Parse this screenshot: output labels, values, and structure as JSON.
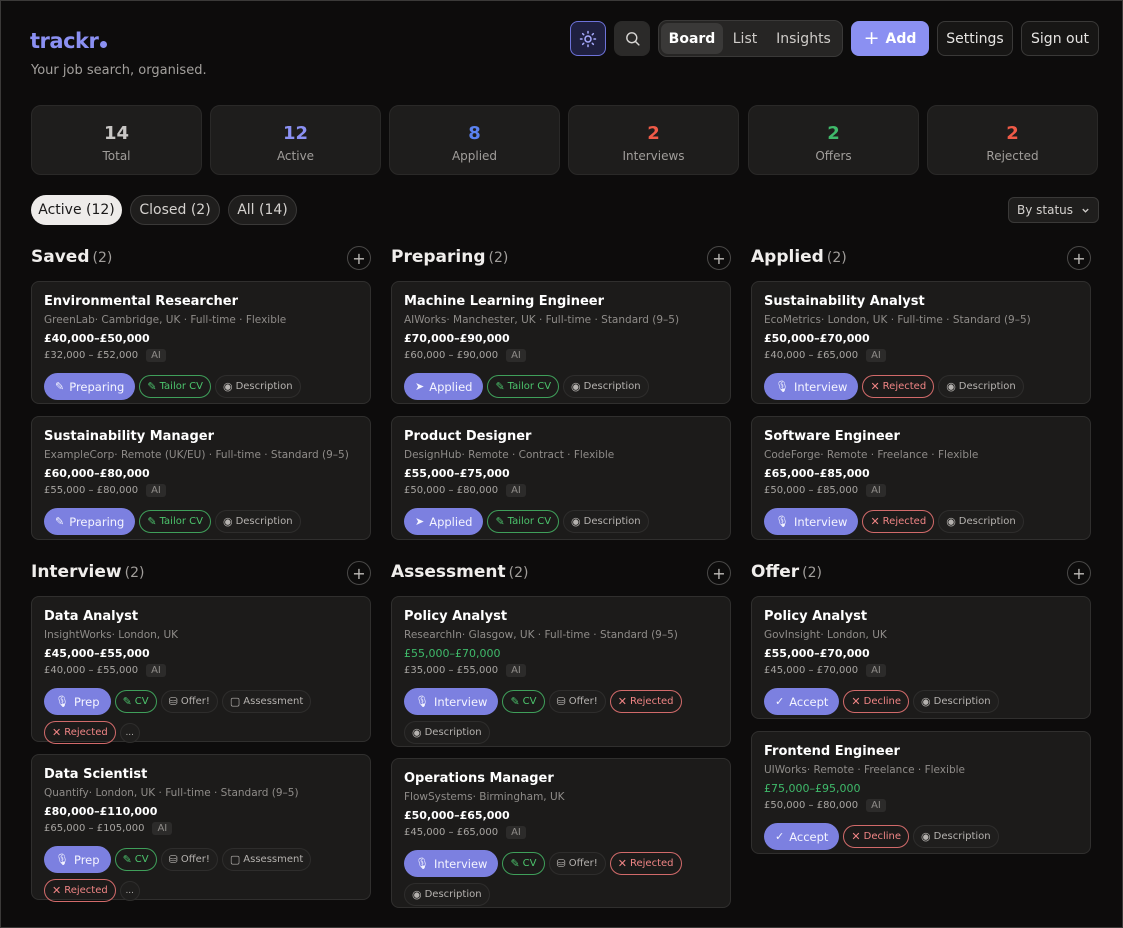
{
  "brand": {
    "name": "trackr",
    "tagline": "Your job search, organised."
  },
  "header": {
    "theme_icon": "sun-icon",
    "search_icon": "search-icon",
    "views": [
      "Board",
      "List",
      "Insights"
    ],
    "active_view": "Board",
    "add_label": "Add",
    "settings_label": "Settings",
    "signout_label": "Sign out"
  },
  "stats": [
    {
      "value": "14",
      "label": "Total",
      "color": "#c8c6c4"
    },
    {
      "value": "12",
      "label": "Active",
      "color": "#8b90f2"
    },
    {
      "value": "8",
      "label": "Applied",
      "color": "#5b82f0"
    },
    {
      "value": "2",
      "label": "Interviews",
      "color": "#ef5a47"
    },
    {
      "value": "2",
      "label": "Offers",
      "color": "#3fb96a"
    },
    {
      "value": "2",
      "label": "Rejected",
      "color": "#ef5a47"
    }
  ],
  "filters": {
    "chips": [
      "Active (12)",
      "Closed (2)",
      "All (14)"
    ],
    "active": "Active (12)",
    "sort_label": "By status"
  },
  "columns": [
    {
      "title": "Saved",
      "count": "(2)",
      "cards": [
        {
          "title": "Environmental Researcher",
          "meta": "GreenLab· Cambridge, UK · Full-time · Flexible",
          "salary": "£40,000–£50,000",
          "salary_green": false,
          "ai_range": "£32,000 – £52,000",
          "ai": "AI",
          "actions": [
            {
              "label": "Preparing",
              "kind": "primary",
              "icon": "✎",
              "icon_name": "pencil-icon"
            },
            {
              "label": "Tailor CV",
              "kind": "green",
              "icon": "✎",
              "icon_name": "pencil-icon"
            },
            {
              "label": "Description",
              "kind": "gray",
              "icon": "◉",
              "icon_name": "eye-icon"
            }
          ]
        },
        {
          "title": "Sustainability Manager",
          "meta": "ExampleCorp· Remote (UK/EU) · Full-time · Standard (9–5)",
          "salary": "£60,000–£80,000",
          "salary_green": false,
          "ai_range": "£55,000 – £80,000",
          "ai": "AI",
          "actions": [
            {
              "label": "Preparing",
              "kind": "primary",
              "icon": "✎",
              "icon_name": "pencil-icon"
            },
            {
              "label": "Tailor CV",
              "kind": "green",
              "icon": "✎",
              "icon_name": "pencil-icon"
            },
            {
              "label": "Description",
              "kind": "gray",
              "icon": "◉",
              "icon_name": "eye-icon"
            }
          ]
        }
      ]
    },
    {
      "title": "Preparing",
      "count": "(2)",
      "cards": [
        {
          "title": "Machine Learning Engineer",
          "meta": "AIWorks· Manchester, UK · Full-time · Standard (9–5)",
          "salary": "£70,000–£90,000",
          "salary_green": false,
          "ai_range": "£60,000 – £90,000",
          "ai": "AI",
          "actions": [
            {
              "label": "Applied",
              "kind": "primary",
              "icon": "➤",
              "icon_name": "send-icon"
            },
            {
              "label": "Tailor CV",
              "kind": "green",
              "icon": "✎",
              "icon_name": "pencil-icon"
            },
            {
              "label": "Description",
              "kind": "gray",
              "icon": "◉",
              "icon_name": "eye-icon"
            }
          ]
        },
        {
          "title": "Product Designer",
          "meta": "DesignHub· Remote · Contract · Flexible",
          "salary": "£55,000–£75,000",
          "salary_green": false,
          "ai_range": "£50,000 – £80,000",
          "ai": "AI",
          "actions": [
            {
              "label": "Applied",
              "kind": "primary",
              "icon": "➤",
              "icon_name": "send-icon"
            },
            {
              "label": "Tailor CV",
              "kind": "green",
              "icon": "✎",
              "icon_name": "pencil-icon"
            },
            {
              "label": "Description",
              "kind": "gray",
              "icon": "◉",
              "icon_name": "eye-icon"
            }
          ]
        }
      ]
    },
    {
      "title": "Applied",
      "count": "(2)",
      "cards": [
        {
          "title": "Sustainability Analyst",
          "meta": "EcoMetrics· London, UK · Full-time · Standard (9–5)",
          "salary": "£50,000–£70,000",
          "salary_green": false,
          "ai_range": "£40,000 – £65,000",
          "ai": "AI",
          "actions": [
            {
              "label": "Interview",
              "kind": "primary",
              "icon": "🎙",
              "icon_name": "microphone-icon"
            },
            {
              "label": "Rejected",
              "kind": "red",
              "icon": "✕",
              "icon_name": "x-icon"
            },
            {
              "label": "Description",
              "kind": "gray",
              "icon": "◉",
              "icon_name": "eye-icon"
            }
          ]
        },
        {
          "title": "Software Engineer",
          "meta": "CodeForge· Remote · Freelance · Flexible",
          "salary": "£65,000–£85,000",
          "salary_green": false,
          "ai_range": "£50,000 – £85,000",
          "ai": "AI",
          "actions": [
            {
              "label": "Interview",
              "kind": "primary",
              "icon": "🎙",
              "icon_name": "microphone-icon"
            },
            {
              "label": "Rejected",
              "kind": "red",
              "icon": "✕",
              "icon_name": "x-icon"
            },
            {
              "label": "Description",
              "kind": "gray",
              "icon": "◉",
              "icon_name": "eye-icon"
            }
          ]
        }
      ]
    },
    {
      "title": "Interview",
      "count": "(2)",
      "cards": [
        {
          "title": "Data Analyst",
          "meta": "InsightWorks· London, UK",
          "salary": "£45,000–£55,000",
          "salary_green": false,
          "ai_range": "£40,000 – £55,000",
          "ai": "AI",
          "actions": [
            {
              "label": "Prep",
              "kind": "primary",
              "icon": "🎙",
              "icon_name": "microphone-icon"
            },
            {
              "label": "CV",
              "kind": "green",
              "icon": "✎",
              "icon_name": "pencil-icon"
            },
            {
              "label": "Offer!",
              "kind": "gray",
              "icon": "⛁",
              "icon_name": "gift-icon"
            },
            {
              "label": "Assessment",
              "kind": "gray",
              "icon": "▢",
              "icon_name": "clipboard-icon"
            },
            {
              "label": "Rejected",
              "kind": "red",
              "icon": "✕",
              "icon_name": "x-icon"
            },
            {
              "label": "...",
              "kind": "more",
              "icon": "",
              "icon_name": "more-icon"
            }
          ]
        },
        {
          "title": "Data Scientist",
          "meta": "Quantify· London, UK · Full-time · Standard (9–5)",
          "salary": "£80,000–£110,000",
          "salary_green": false,
          "ai_range": "£65,000 – £105,000",
          "ai": "AI",
          "actions": [
            {
              "label": "Prep",
              "kind": "primary",
              "icon": "🎙",
              "icon_name": "microphone-icon"
            },
            {
              "label": "CV",
              "kind": "green",
              "icon": "✎",
              "icon_name": "pencil-icon"
            },
            {
              "label": "Offer!",
              "kind": "gray",
              "icon": "⛁",
              "icon_name": "gift-icon"
            },
            {
              "label": "Assessment",
              "kind": "gray",
              "icon": "▢",
              "icon_name": "clipboard-icon"
            },
            {
              "label": "Rejected",
              "kind": "red",
              "icon": "✕",
              "icon_name": "x-icon"
            },
            {
              "label": "...",
              "kind": "more",
              "icon": "",
              "icon_name": "more-icon"
            }
          ]
        }
      ]
    },
    {
      "title": "Assessment",
      "count": "(2)",
      "cards": [
        {
          "title": "Policy Analyst",
          "meta": "ResearchIn· Glasgow, UK · Full-time · Standard (9–5)",
          "salary": "£55,000–£70,000",
          "salary_green": true,
          "ai_range": "£35,000 – £55,000",
          "ai": "AI",
          "actions": [
            {
              "label": "Interview",
              "kind": "primary",
              "icon": "🎙",
              "icon_name": "microphone-icon"
            },
            {
              "label": "CV",
              "kind": "green",
              "icon": "✎",
              "icon_name": "pencil-icon"
            },
            {
              "label": "Offer!",
              "kind": "gray",
              "icon": "⛁",
              "icon_name": "gift-icon"
            },
            {
              "label": "Rejected",
              "kind": "red",
              "icon": "✕",
              "icon_name": "x-icon"
            },
            {
              "label": "Description",
              "kind": "gray",
              "icon": "◉",
              "icon_name": "eye-icon"
            }
          ]
        },
        {
          "title": "Operations Manager",
          "meta": "FlowSystems· Birmingham, UK",
          "salary": "£50,000–£65,000",
          "salary_green": false,
          "ai_range": "£45,000 – £65,000",
          "ai": "AI",
          "actions": [
            {
              "label": "Interview",
              "kind": "primary",
              "icon": "🎙",
              "icon_name": "microphone-icon"
            },
            {
              "label": "CV",
              "kind": "green",
              "icon": "✎",
              "icon_name": "pencil-icon"
            },
            {
              "label": "Offer!",
              "kind": "gray",
              "icon": "⛁",
              "icon_name": "gift-icon"
            },
            {
              "label": "Rejected",
              "kind": "red",
              "icon": "✕",
              "icon_name": "x-icon"
            },
            {
              "label": "Description",
              "kind": "gray",
              "icon": "◉",
              "icon_name": "eye-icon"
            }
          ]
        }
      ]
    },
    {
      "title": "Offer",
      "count": "(2)",
      "cards": [
        {
          "title": "Policy Analyst",
          "meta": "GovInsight· London, UK",
          "salary": "£55,000–£70,000",
          "salary_green": false,
          "ai_range": "£45,000 – £70,000",
          "ai": "AI",
          "actions": [
            {
              "label": "Accept",
              "kind": "primary",
              "icon": "✓",
              "icon_name": "check-icon"
            },
            {
              "label": "Decline",
              "kind": "red",
              "icon": "✕",
              "icon_name": "x-icon"
            },
            {
              "label": "Description",
              "kind": "gray",
              "icon": "◉",
              "icon_name": "eye-icon"
            }
          ]
        },
        {
          "title": "Frontend Engineer",
          "meta": "UIWorks· Remote · Freelance · Flexible",
          "salary": "£75,000–£95,000",
          "salary_green": true,
          "ai_range": "£50,000 – £80,000",
          "ai": "AI",
          "actions": [
            {
              "label": "Accept",
              "kind": "primary",
              "icon": "✓",
              "icon_name": "check-icon"
            },
            {
              "label": "Decline",
              "kind": "red",
              "icon": "✕",
              "icon_name": "x-icon"
            },
            {
              "label": "Description",
              "kind": "gray",
              "icon": "◉",
              "icon_name": "eye-icon"
            }
          ]
        }
      ]
    }
  ]
}
